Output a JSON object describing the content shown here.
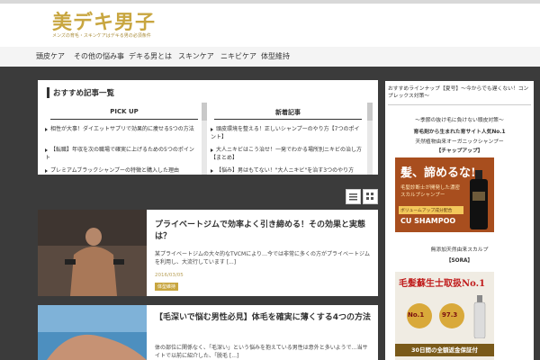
{
  "header": {
    "logo": "美デキ男子",
    "tagline": "メンズの育毛・スキンケアはデキる男の必須条件"
  },
  "nav": {
    "items": [
      "頭皮ケア",
      "その他の悩み事",
      "デキる男とは",
      "スキンケア",
      "ニキビケア",
      "体型維持"
    ]
  },
  "recommend": {
    "title": "おすすめ記事一覧",
    "pickup": {
      "heading": "PICK UP",
      "items": [
        "相性が大事！ダイエットサプリで効果的に痩せる5つの方法",
        "【転職】年収を次の職場で確実に上げるための5つのポイント",
        "プレミアムブラックシャンプーの特徴と購入した理由"
      ]
    },
    "latest": {
      "heading": "新着記事",
      "items": [
        "頭皮環境を整える！正しいシャンプーのやり方【7つのポイント】",
        "大人ニキビはこう治せ！一発でわかる場所別ニキビの治し方【まとめ】",
        "【悩み】男はもてない！\"大人ニキビ\"を治す3つのやり方"
      ]
    }
  },
  "articles": [
    {
      "title": "プライベートジムで効率よく引き締める！その効果と実態は？",
      "excerpt": "某プライベートジムの大々的なTVCMにより…今では非常に多くの方がプライベートジムを利用し、大流行しています [...]",
      "date": "2016/03/05",
      "category": "体型維持"
    },
    {
      "title": "【毛深いで悩む男性必見】体毛を確実に薄くする4つの方法",
      "excerpt": "体の部位に関係なく、「毛深い」という悩みを抱えている男性は意外と多いようで…当サイトで以前に紹介した、「脱毛 [...]",
      "date": "",
      "category": ""
    }
  ],
  "sidebar": {
    "title": "おすすめラインナップ【夏号】〜今からでも遅くない！コンプレックス対策〜",
    "lead": "〜季節の抜け毛に負けない頭皮対策〜",
    "lead2": "育毛剤から生まれた育サイト人気No.1",
    "lead3": "天然植物由来オーガニックシャンプー",
    "ad1_label": "【チャップアップ】",
    "ad1_headline": "髪、諦めるな!",
    "ad1_sub": "毛髪診断士が開発した濃密スカルプシャンプー",
    "ad1_product": "CU SHAMPOO",
    "ad1_badge": "ボリュームアップ成分配合",
    "ad2_lead": "無添加天然由来スカルプ",
    "ad2_label": "【SORA】",
    "ad2_headline": "毛髪蘇生士取扱No.1",
    "ad2_stat1": "No.1",
    "ad2_stat2": "97.3",
    "ad2_foot": "30日間の全額返金保証付"
  },
  "colors": {
    "accent": "#c8a640",
    "background": "#3a3a3a"
  }
}
